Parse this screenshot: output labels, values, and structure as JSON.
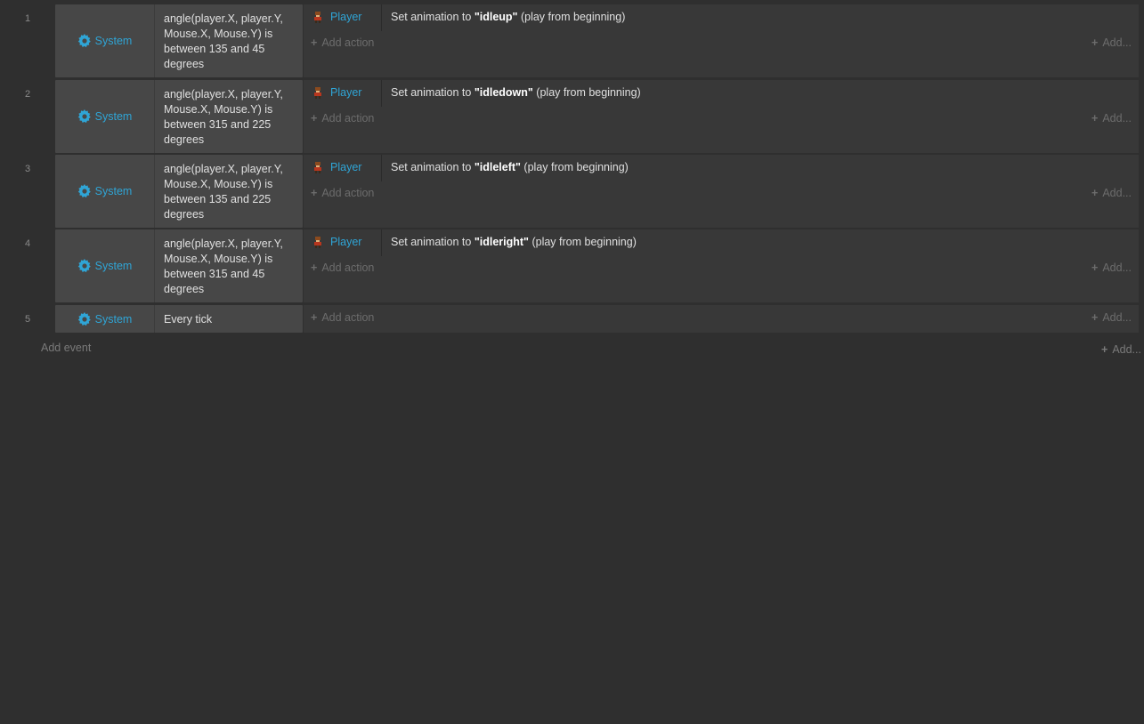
{
  "events": [
    {
      "number": "1",
      "condition_object": "System",
      "condition_text": "angle(player.X, player.Y, Mouse.X, Mouse.Y) is between 135 and 45 degrees",
      "action_object": "Player",
      "action_prefix": "Set animation to ",
      "action_value": "\"idleup\"",
      "action_suffix": " (play from beginning)"
    },
    {
      "number": "2",
      "condition_object": "System",
      "condition_text": "angle(player.X, player.Y, Mouse.X, Mouse.Y) is between 315 and 225 degrees",
      "action_object": "Player",
      "action_prefix": "Set animation to ",
      "action_value": "\"idledown\"",
      "action_suffix": " (play from beginning)"
    },
    {
      "number": "3",
      "condition_object": "System",
      "condition_text": "angle(player.X, player.Y, Mouse.X, Mouse.Y) is between 135 and 225 degrees",
      "action_object": "Player",
      "action_prefix": "Set animation to ",
      "action_value": "\"idleleft\"",
      "action_suffix": " (play from beginning)"
    },
    {
      "number": "4",
      "condition_object": "System",
      "condition_text": "angle(player.X, player.Y, Mouse.X, Mouse.Y) is between 315 and 45 degrees",
      "action_object": "Player",
      "action_prefix": "Set animation to ",
      "action_value": "\"idleright\"",
      "action_suffix": " (play from beginning)"
    },
    {
      "number": "5",
      "condition_object": "System",
      "condition_text": "Every tick"
    }
  ],
  "labels": {
    "add_action": "Add action",
    "add_right": "Add...",
    "add_event": "Add event",
    "plus": "+"
  },
  "icons": {
    "condition": "gear-icon",
    "action": "player-sprite-icon"
  },
  "colors": {
    "object_link": "#2fa5d6",
    "background": "#2f2f2f",
    "condition_bg": "#474747",
    "action_bg": "#383838"
  }
}
